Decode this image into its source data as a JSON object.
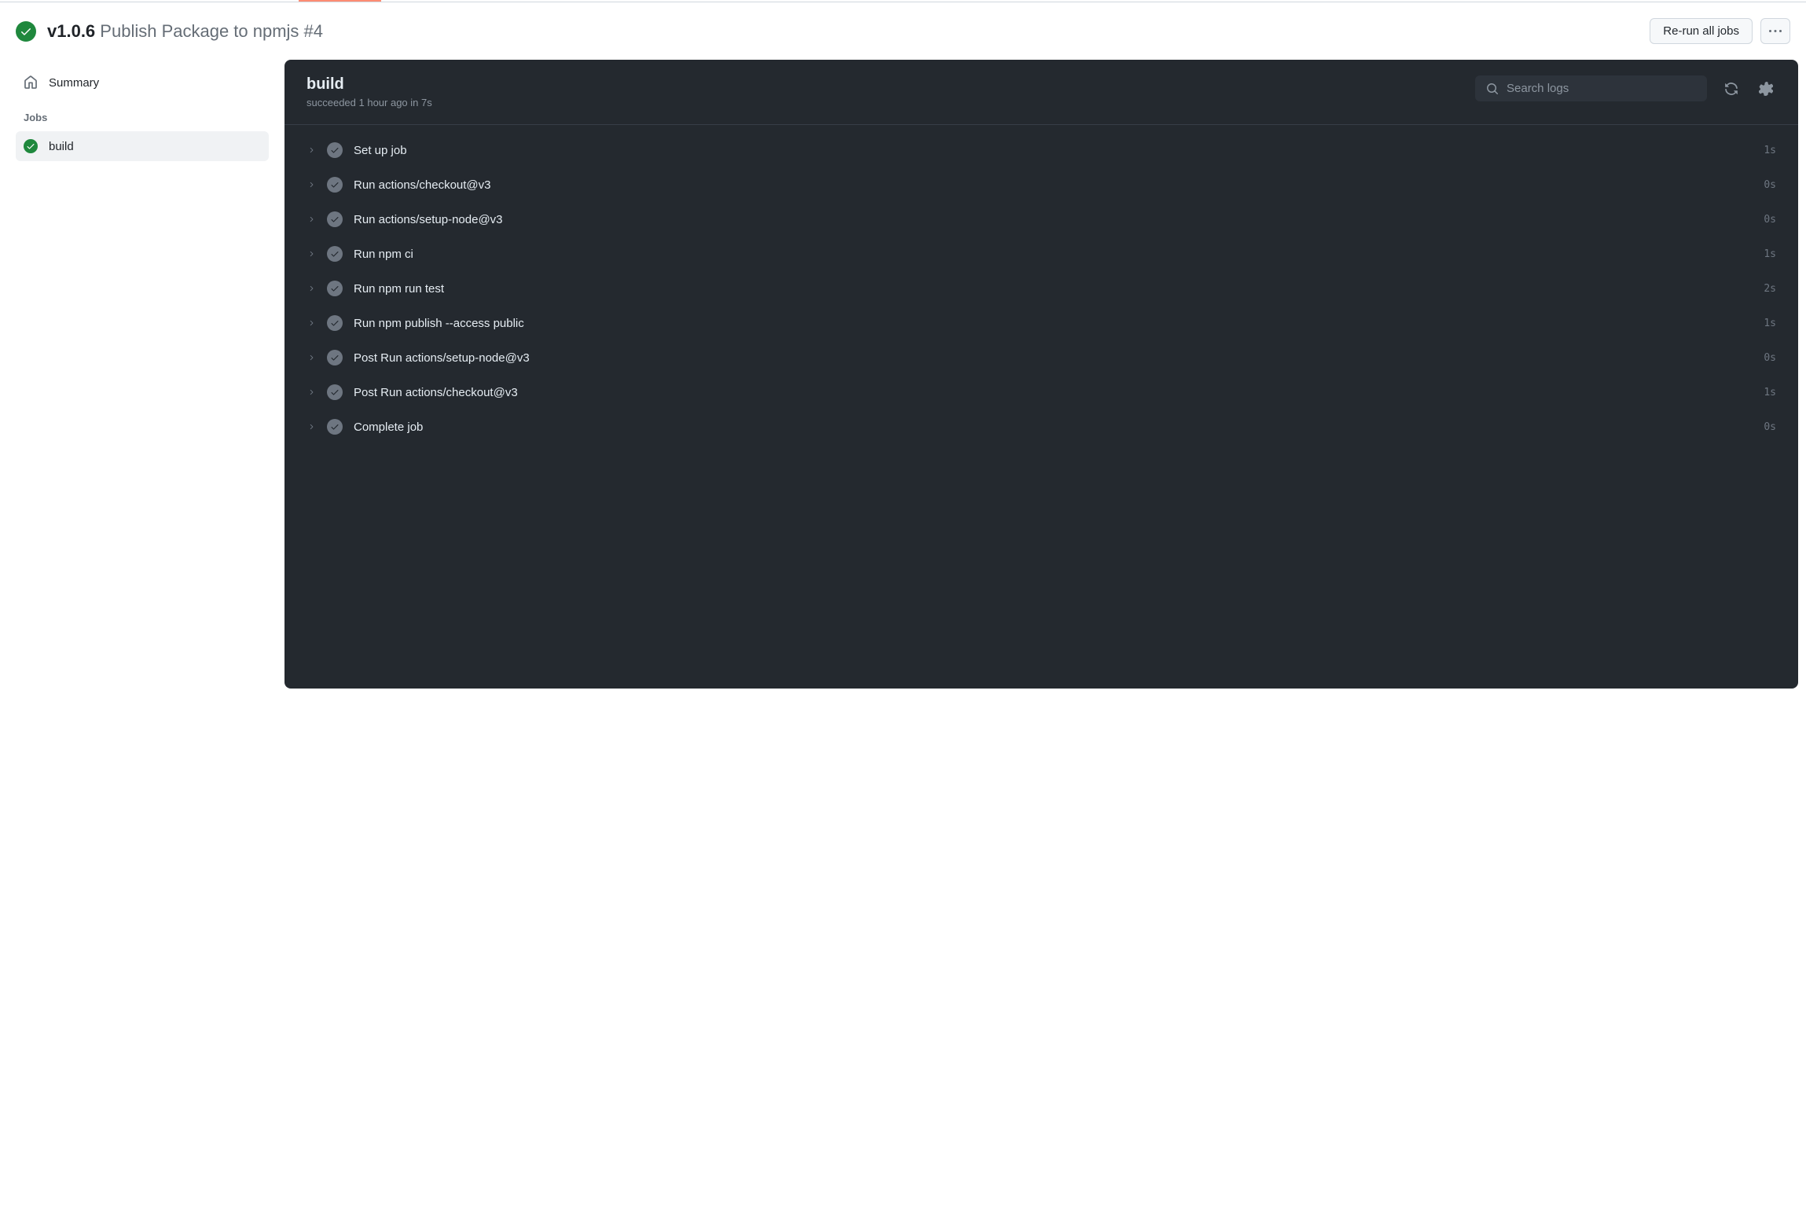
{
  "header": {
    "version": "v1.0.6",
    "subtitle": "Publish Package to npmjs #4",
    "rerun_label": "Re-run all jobs"
  },
  "sidebar": {
    "summary_label": "Summary",
    "jobs_title": "Jobs",
    "jobs": [
      {
        "label": "build"
      }
    ]
  },
  "panel": {
    "title": "build",
    "subtitle": "succeeded 1 hour ago in 7s",
    "search_placeholder": "Search logs"
  },
  "steps": [
    {
      "label": "Set up job",
      "duration": "1s"
    },
    {
      "label": "Run actions/checkout@v3",
      "duration": "0s"
    },
    {
      "label": "Run actions/setup-node@v3",
      "duration": "0s"
    },
    {
      "label": "Run npm ci",
      "duration": "1s"
    },
    {
      "label": "Run npm run test",
      "duration": "2s"
    },
    {
      "label": "Run npm publish --access public",
      "duration": "1s"
    },
    {
      "label": "Post Run actions/setup-node@v3",
      "duration": "0s"
    },
    {
      "label": "Post Run actions/checkout@v3",
      "duration": "1s"
    },
    {
      "label": "Complete job",
      "duration": "0s"
    }
  ]
}
